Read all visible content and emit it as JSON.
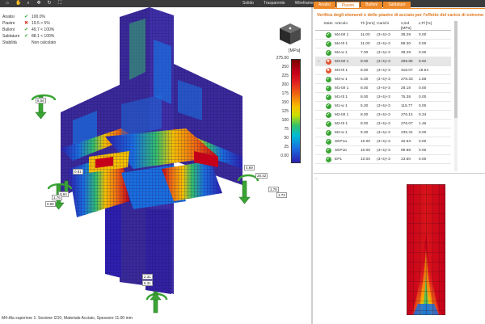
{
  "toolbar": {
    "icons": [
      "home-icon",
      "pan-icon",
      "zoom-icon",
      "move-icon",
      "rotate-icon",
      "zoom-fit-icon"
    ],
    "views": [
      "Solido",
      "Trasparente",
      "Wireframe"
    ]
  },
  "status": [
    {
      "label": "Analisi",
      "state": "ok",
      "value": "100.0%"
    },
    {
      "label": "Piastre",
      "state": "bad",
      "value": "19.5 > 5%"
    },
    {
      "label": "Bulloni",
      "state": "ok",
      "value": "49.7 < 100%"
    },
    {
      "label": "Saldature",
      "state": "ok",
      "value": "88.1 < 100%"
    },
    {
      "label": "Stabilità",
      "state": "none",
      "value": "Non calcolato"
    }
  ],
  "legend": {
    "unit": "[MPa]",
    "labels": [
      "275.00",
      "250",
      "225",
      "200",
      "175",
      "150",
      "125",
      "100",
      "75",
      "50",
      "25",
      "0.00"
    ]
  },
  "viewport_labels": {
    "l1": "6.56",
    "l2": "0.81",
    "l3": "0.84",
    "l4": "1.76",
    "l5": "0.65",
    "r1": "4.69",
    "r2": "28.42",
    "r3": "1.76",
    "r4": "1.73",
    "b1": "2.31",
    "b2": "6.31"
  },
  "caption": "M4-Ala superiore  1: Sezione I210, Materiale Acciaio, Spessore 11.00 mm",
  "panel": {
    "tabs": [
      "Analisi",
      "Piastre",
      "Bulloni",
      "Saldature"
    ],
    "active_tab": "Piastre",
    "title": "Verifica degli elementi e delle piastre di acciaio per l'effetto del carico di estremo",
    "columns": [
      "Stato",
      "Articolo",
      "Th [mm]",
      "Carichi",
      "σ,Ed [MPa]",
      "ε,Pl [%]"
    ],
    "rows": [
      {
        "state": "ok",
        "item": "M4-bfl 1",
        "th": "11.00",
        "load": "(3+4)+3",
        "sig": "38.29",
        "eps": "0.00"
      },
      {
        "state": "ok",
        "item": "M4-tfl 1",
        "th": "11.00",
        "load": "(3+4)+3",
        "sig": "88.30",
        "eps": "0.00"
      },
      {
        "state": "ok",
        "item": "M4-w 1",
        "th": "7.00",
        "load": "(3+4)+3",
        "sig": "38.29",
        "eps": "0.00"
      },
      {
        "state": "bad",
        "item": "M3-bfl 1",
        "th": "8.00",
        "load": "(3+4)+3",
        "sig": "295.85",
        "eps": "9.92",
        "selected": true
      },
      {
        "state": "bad",
        "item": "M3-tfl 1",
        "th": "8.00",
        "load": "(3+4)+3",
        "sig": "316.07",
        "eps": "19.54"
      },
      {
        "state": "ok",
        "item": "M3-w 1",
        "th": "5.30",
        "load": "(3+4)+3",
        "sig": "278.33",
        "eps": "1.58"
      },
      {
        "state": "ok",
        "item": "M1-bfl 1",
        "th": "8.00",
        "load": "(3+4)+3",
        "sig": "28.18",
        "eps": "0.00"
      },
      {
        "state": "ok",
        "item": "M1-tfl 1",
        "th": "8.00",
        "load": "(3+4)+3",
        "sig": "75.38",
        "eps": "0.00"
      },
      {
        "state": "ok",
        "item": "M1-w 1",
        "th": "5.30",
        "load": "(3+4)+3",
        "sig": "115.77",
        "eps": "0.00"
      },
      {
        "state": "ok",
        "item": "M2-bfl 1",
        "th": "8.00",
        "load": "(3+4)+3",
        "sig": "276.14",
        "eps": "0.34"
      },
      {
        "state": "ok",
        "item": "M2-tfl 1",
        "th": "8.00",
        "load": "(3+4)+3",
        "sig": "276.07",
        "eps": "1.46"
      },
      {
        "state": "ok",
        "item": "M2-w 1",
        "th": "5.30",
        "load": "(3+4)+3",
        "sig": "235.31",
        "eps": "0.00"
      },
      {
        "state": "ok",
        "item": "SEP1a",
        "th": "10.00",
        "load": "(3+4)+3",
        "sig": "32.63",
        "eps": "0.00"
      },
      {
        "state": "ok",
        "item": "SEP1b",
        "th": "10.00",
        "load": "(3+4)+3",
        "sig": "99.88",
        "eps": "0.00"
      },
      {
        "state": "ok",
        "item": "EP1",
        "th": "10.00",
        "load": "(3+4)+3",
        "sig": "23.60",
        "eps": "0.00"
      }
    ]
  },
  "colors": {
    "accent": "#ef8a2a",
    "ok": "#3aa535",
    "bad": "#e2552f",
    "mesh_low": "#2d1fb0",
    "mesh_high": "#c4001a"
  }
}
